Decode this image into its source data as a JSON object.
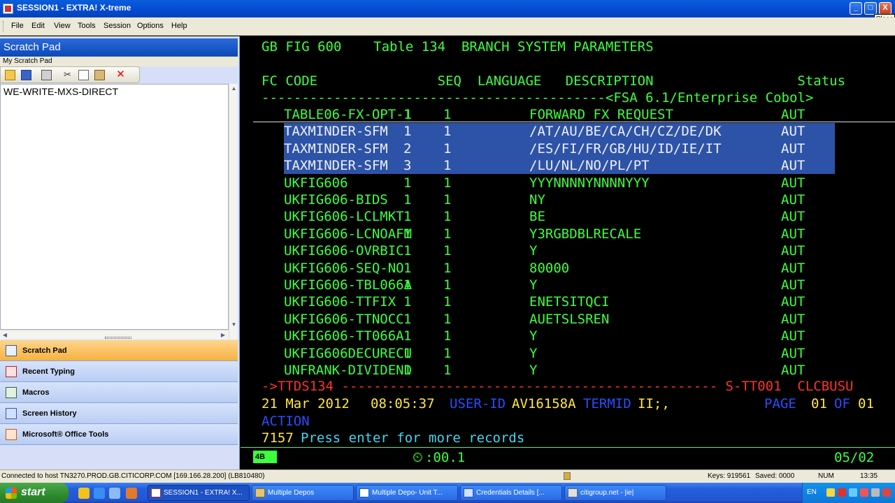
{
  "window": {
    "title": "SESSION1 - EXTRA! X-treme",
    "close_tooltip": "Close",
    "buttons": {
      "minimize": "_",
      "maximize": "□",
      "close": "X"
    }
  },
  "menu": [
    "File",
    "Edit",
    "View",
    "Tools",
    "Session",
    "Options",
    "Help"
  ],
  "scratch_pad": {
    "header": "Scratch Pad",
    "sub": "My Scratch Pad",
    "content": "WE-WRITE-MXS-DIRECT"
  },
  "nav": [
    {
      "label": "Scratch Pad",
      "icon": "notepad-icon",
      "active": true
    },
    {
      "label": "Recent Typing",
      "icon": "pencil-icon",
      "active": false
    },
    {
      "label": "Macros",
      "icon": "macro-icon",
      "active": false
    },
    {
      "label": "Screen History",
      "icon": "screen-history-icon",
      "active": false
    },
    {
      "label": "Microsoft® Office Tools",
      "icon": "office-tools-icon",
      "active": false
    }
  ],
  "terminal": {
    "header": "GB FIG 600    Table 134  BRANCH SYSTEM PARAMETERS",
    "columns": "FC CODE               SEQ  LANGUAGE   DESCRIPTION                  Status",
    "separator": "-------------------------------------------<FSA 6.1/Enterprise Cobol>",
    "rows": [
      {
        "code": "TABLE06-FX-OPT-1",
        "seq": "1",
        "lang": "1",
        "desc": "FORWARD FX REQUEST",
        "status": "AUT"
      },
      {
        "code": "TAXMINDER-SFM",
        "seq": "1",
        "lang": "1",
        "desc": "/AT/AU/BE/CA/CH/CZ/DE/DK",
        "status": "AUT"
      },
      {
        "code": "TAXMINDER-SFM",
        "seq": "2",
        "lang": "1",
        "desc": "/ES/FI/FR/GB/HU/ID/IE/IT",
        "status": "AUT"
      },
      {
        "code": "TAXMINDER-SFM",
        "seq": "3",
        "lang": "1",
        "desc": "/LU/NL/NO/PL/PT",
        "status": "AUT"
      },
      {
        "code": "UKFIG606",
        "seq": "1",
        "lang": "1",
        "desc": "YYYNNNNYNNNNYYY",
        "status": "AUT"
      },
      {
        "code": "UKFIG606-BIDS",
        "seq": "1",
        "lang": "1",
        "desc": "NY",
        "status": "AUT"
      },
      {
        "code": "UKFIG606-LCLMKT",
        "seq": "1",
        "lang": "1",
        "desc": "BE",
        "status": "AUT"
      },
      {
        "code": "UKFIG606-LCNOAFM",
        "seq": "1",
        "lang": "1",
        "desc": "Y3RGBDBLRECALE",
        "status": "AUT"
      },
      {
        "code": "UKFIG606-OVRBIC",
        "seq": "1",
        "lang": "1",
        "desc": "Y",
        "status": "AUT"
      },
      {
        "code": "UKFIG606-SEQ-NO",
        "seq": "1",
        "lang": "1",
        "desc": "80000",
        "status": "AUT"
      },
      {
        "code": "UKFIG606-TBL066A",
        "seq": "1",
        "lang": "1",
        "desc": "Y",
        "status": "AUT"
      },
      {
        "code": "UKFIG606-TTFIX",
        "seq": "1",
        "lang": "1",
        "desc": "ENETSITQCI",
        "status": "AUT"
      },
      {
        "code": "UKFIG606-TTNOCC",
        "seq": "1",
        "lang": "1",
        "desc": "AUETSLSREN",
        "status": "AUT"
      },
      {
        "code": "UKFIG606-TT066A",
        "seq": "1",
        "lang": "1",
        "desc": "Y",
        "status": "AUT"
      },
      {
        "code": "UKFIG606DECURECU",
        "seq": "1",
        "lang": "1",
        "desc": "Y",
        "status": "AUT"
      },
      {
        "code": "UNFRANK-DIVIDEND",
        "seq": "1",
        "lang": "1",
        "desc": "Y",
        "status": "AUT"
      }
    ],
    "cmd_line": "->TTDS134 ----------------------------------------------- S-TT001  CLCBUSU",
    "date": "21 Mar 2012",
    "time": "08:05:37",
    "userid_label": "USER-ID",
    "userid": "AV16158A",
    "termid_label": "TERMID",
    "termid": "II;,",
    "page_label": "PAGE",
    "page": "01",
    "of_label": "OF",
    "of": "01",
    "action_label": "ACTION",
    "msg_num": "7157",
    "msg": "Press enter for more records",
    "oia_box": "4B",
    "oia_timer": ":00.1",
    "oia_cursor": "05/02"
  },
  "statusbar": {
    "connected": "Connected to host TN3270.PROD.GB.CITICORP.COM [169.166.28.200] (LB810480)",
    "keys": "Keys: 919561",
    "saved": "Saved: 0000",
    "num": "NUM",
    "clock": "13:35"
  },
  "taskbar": {
    "start": "start",
    "tasks": [
      "SESSION1 - EXTRA! X...",
      "Multiple Depos",
      "Multiple Depo- Unit T...",
      "Credentials Details [...",
      "citigroup.net - |ie|"
    ],
    "lang": "EN"
  },
  "colors": {
    "terminal_green": "#3dff3d",
    "terminal_cyan": "#3dd9f0",
    "terminal_red": "#ff3030",
    "terminal_yellow": "#ffe83a",
    "terminal_blue": "#2a4cff",
    "highlight": "#2d53a8"
  }
}
